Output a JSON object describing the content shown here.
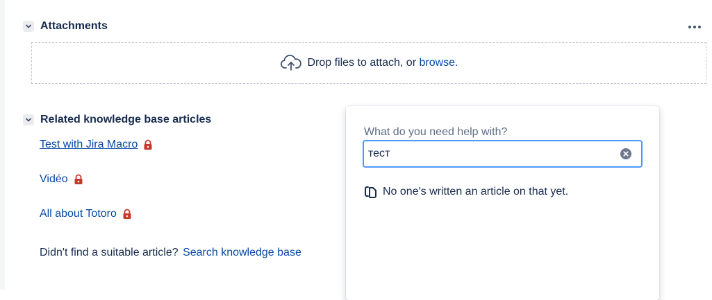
{
  "attachments": {
    "title": "Attachments",
    "drop_text": "Drop files to attach, or ",
    "browse_label": "browse."
  },
  "related": {
    "title": "Related knowledge base articles",
    "articles": [
      {
        "label": "Test with Jira Macro",
        "locked": true
      },
      {
        "label": "Vidéo",
        "locked": true
      },
      {
        "label": "All about Totoro",
        "locked": true
      }
    ],
    "not_found_text": "Didn't find a suitable article?",
    "search_link": "Search knowledge base"
  },
  "popup": {
    "label": "What do you need help with?",
    "search_value": "тест",
    "empty_message": "No one's written an article on that yet."
  },
  "colors": {
    "link": "#0747a6",
    "lock": "#c9372c",
    "focus_border": "#4c9aff",
    "label": "#5e6c84"
  },
  "icons": [
    "chevron-down-icon",
    "more-icon",
    "cloud-upload-icon",
    "lock-icon",
    "clear-icon",
    "pages-icon"
  ]
}
